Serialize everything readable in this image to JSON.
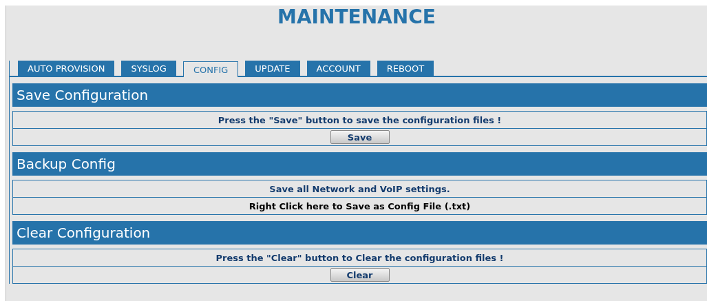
{
  "title": "MAINTENANCE",
  "tabs": [
    {
      "label": "AUTO PROVISION",
      "selected": false
    },
    {
      "label": "SYSLOG",
      "selected": false
    },
    {
      "label": "CONFIG",
      "selected": true
    },
    {
      "label": "UPDATE",
      "selected": false
    },
    {
      "label": "ACCOUNT",
      "selected": false
    },
    {
      "label": "REBOOT",
      "selected": false
    }
  ],
  "sections": [
    {
      "heading": "Save Configuration",
      "rows": [
        {
          "kind": "note",
          "text": "Press the \"Save\" button to save the configuration files !"
        },
        {
          "kind": "button",
          "text": "Save"
        }
      ]
    },
    {
      "heading": "Backup Config",
      "rows": [
        {
          "kind": "note",
          "text": "Save all Network and VoIP settings."
        },
        {
          "kind": "link",
          "text": "Right Click here to Save as Config File (.txt)"
        }
      ]
    },
    {
      "heading": "Clear Configuration",
      "rows": [
        {
          "kind": "note",
          "text": "Press the \"Clear\" button to Clear the configuration files !"
        },
        {
          "kind": "button",
          "text": "Clear"
        }
      ]
    }
  ]
}
